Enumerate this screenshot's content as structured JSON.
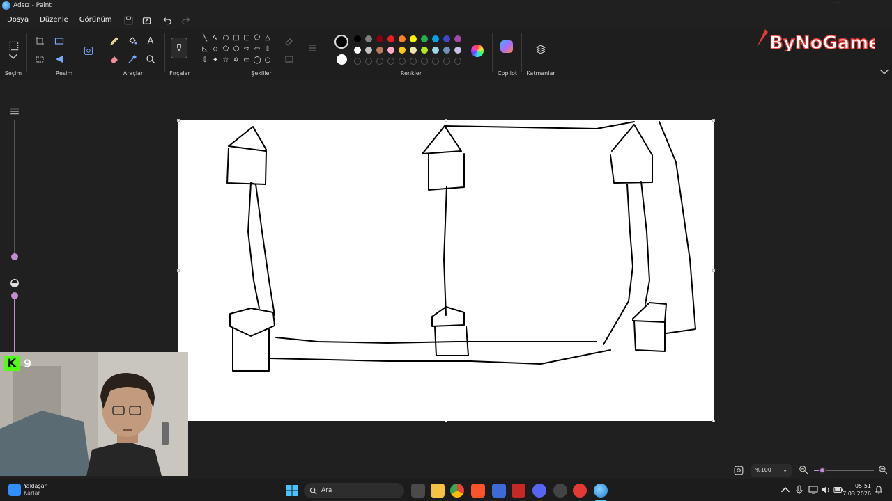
{
  "window": {
    "title": "Adsız - Paint",
    "minimize_glyph": "—"
  },
  "menu": {
    "items": [
      "Dosya",
      "Düzenle",
      "Görünüm"
    ],
    "icons": [
      "save-icon",
      "share-icon",
      "undo-icon",
      "redo-icon"
    ]
  },
  "ribbon": {
    "groups": {
      "selection": "Seçim",
      "image": "Resim",
      "tools": "Araçlar",
      "brushes": "Fırçalar",
      "shapes": "Şekiller",
      "colors": "Renkler",
      "copilot": "Copilot",
      "layers": "Katmanlar"
    },
    "tools": [
      "pencil-icon",
      "fill-icon",
      "text-icon",
      "eraser-icon",
      "color-picker-icon",
      "magnifier-icon"
    ],
    "text_tool_glyph": "A",
    "palette_row1": [
      "#000000",
      "#7f7f7f",
      "#880015",
      "#ed1c24",
      "#ff7f27",
      "#fff200",
      "#22b14c",
      "#00a2e8",
      "#3f48cc",
      "#a349a4"
    ],
    "palette_row2": [
      "#ffffff",
      "#c3c3c3",
      "#b97a57",
      "#ffaec9",
      "#ffc90e",
      "#efe4b0",
      "#b5e61d",
      "#99d9ea",
      "#7092be",
      "#c8bfe7"
    ],
    "primary_color": "#000000",
    "secondary_color": "#ffffff"
  },
  "overlay": {
    "kick_count": "9",
    "kick_logo": "K",
    "brand": "ByNoGame"
  },
  "status": {
    "zoom": "%100"
  },
  "taskbar": {
    "weather_title": "Yaklaşan",
    "weather_subtitle": "Kârlar",
    "search_placeholder": "Ara",
    "time": "05:51",
    "date": "7.03.2026"
  }
}
